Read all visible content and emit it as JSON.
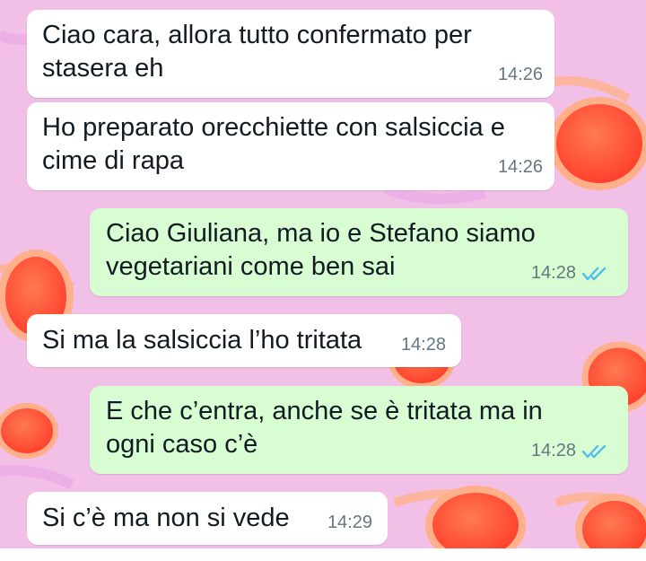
{
  "chat": {
    "messages": [
      {
        "direction": "incoming",
        "text": "Ciao cara, allora tutto confermato per\nstasera eh",
        "time": "14:26"
      },
      {
        "direction": "incoming",
        "text": "Ho preparato orecchiette con salsiccia e\ncime di rapa",
        "time": "14:26"
      },
      {
        "direction": "outgoing",
        "text": "Ciao Giuliana, ma io e Stefano siamo\nvegetariani come ben sai",
        "time": "14:28",
        "status": "read"
      },
      {
        "direction": "incoming",
        "text": "Si ma la salsiccia l’ho tritata",
        "time": "14:28"
      },
      {
        "direction": "outgoing",
        "text": "E che c’entra, anche se è tritata ma in\nogni caso c’è",
        "time": "14:28",
        "status": "read"
      },
      {
        "direction": "incoming",
        "text": "Si c’è ma non si vede",
        "time": "14:29"
      }
    ]
  },
  "colors": {
    "wallpaper": "#f2bfe6",
    "incoming_bubble": "#ffffff",
    "outgoing_bubble": "#d9fdd3",
    "read_ticks": "#53bdeb",
    "sunglasses_lens": "#ff5a3c"
  },
  "icons": {
    "read_receipt": "double-check-icon"
  }
}
